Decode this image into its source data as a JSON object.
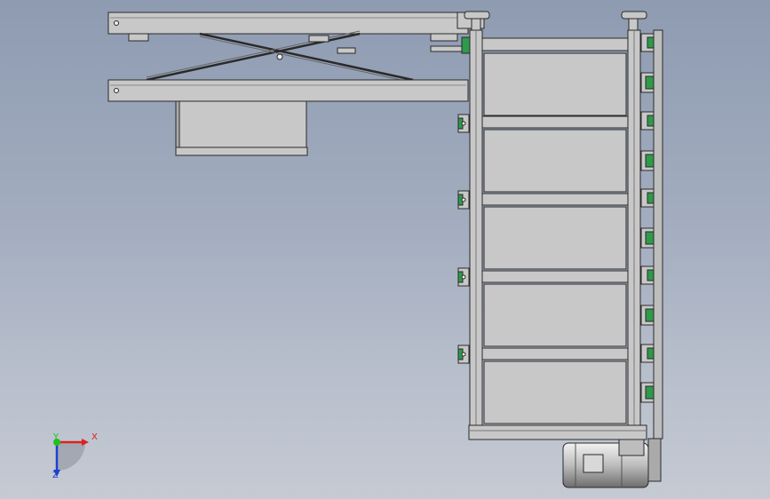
{
  "viewport": {
    "background_top": "#8e9bb1",
    "background_bottom": "#c5cad3"
  },
  "triad": {
    "x_label": "X",
    "y_label": "Y",
    "z_label": "Z",
    "x_color": "#e02020",
    "y_color": "#20c020",
    "z_color": "#2040d0"
  },
  "model": {
    "part_fill": "#c8c8c8",
    "part_edge": "#2a2a2a",
    "roller_color": "#2f9a4a",
    "icons": [
      "scissor-lift-assembly",
      "conveyor-frame-assembly",
      "motor-assembly",
      "coordinate-triad-icon"
    ]
  }
}
